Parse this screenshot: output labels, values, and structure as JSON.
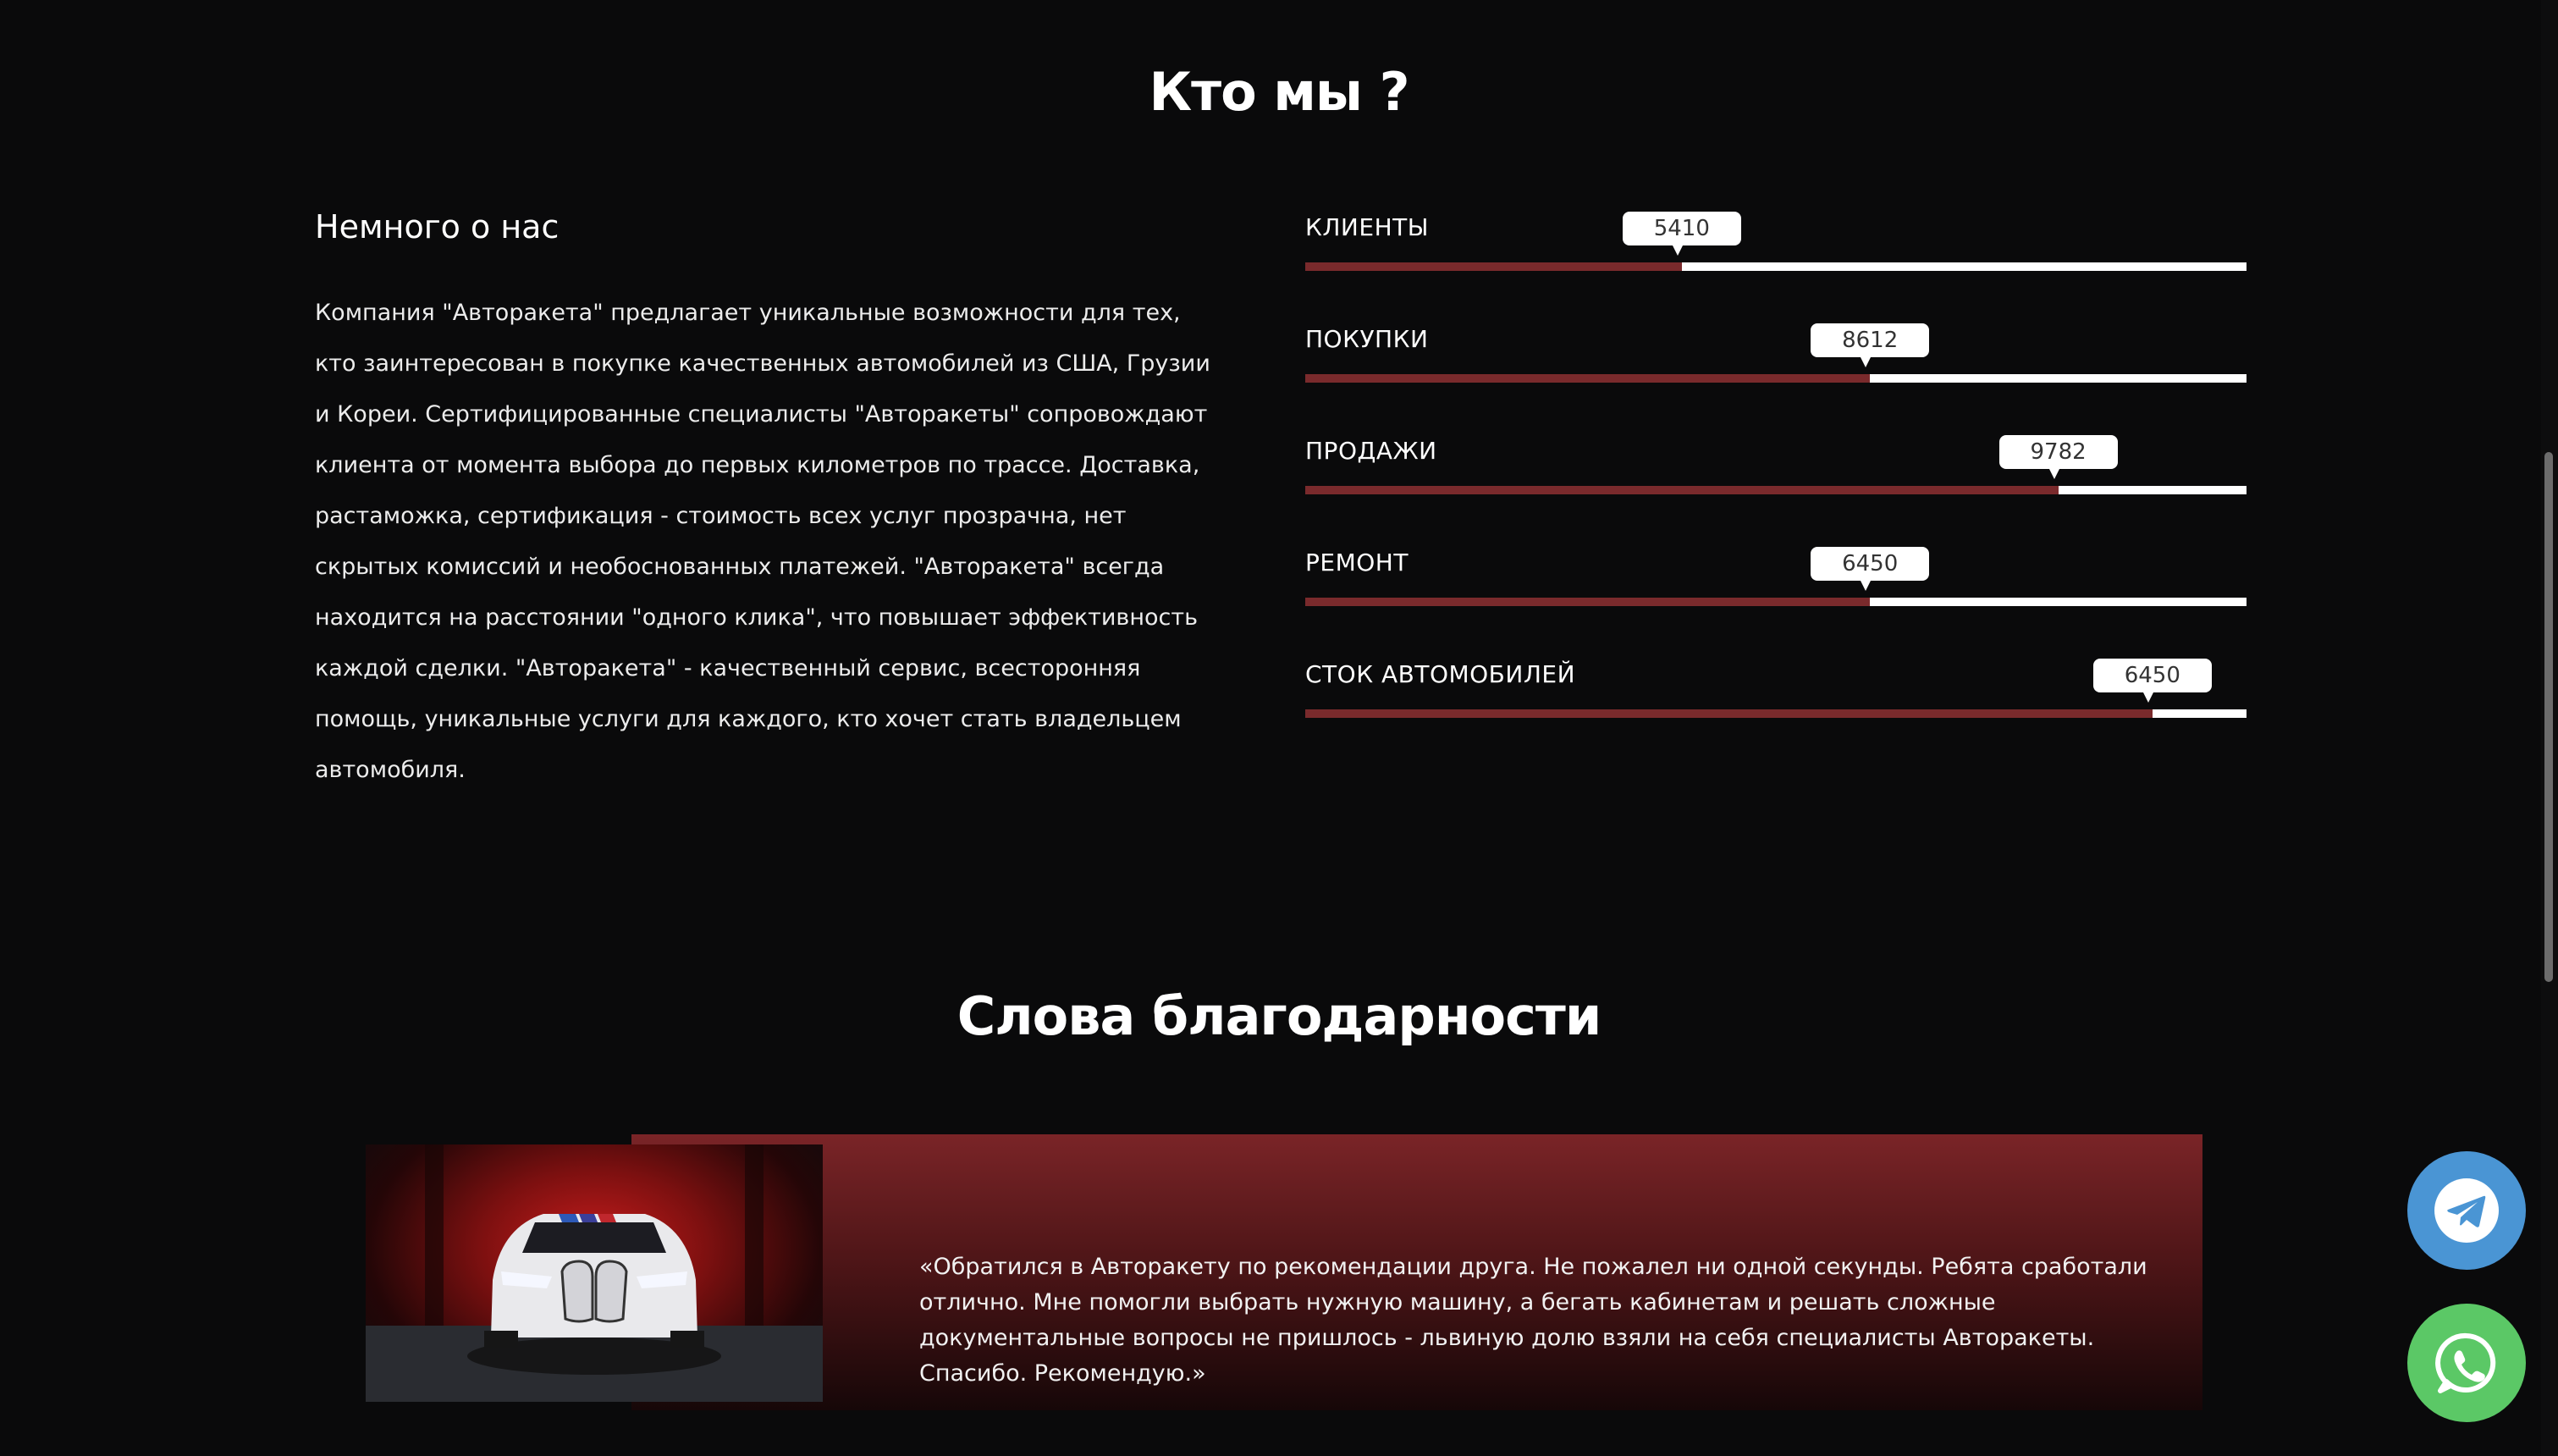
{
  "who": {
    "title": "Кто мы ?",
    "about_heading": "Немного о нас",
    "about_text": "Компания \"Авторакета\" предлагает уникальные возможности для тех, кто заинтересован в покупке качественных автомобилей из США, Грузии и Кореи. Сертифицированные специалисты \"Авторакеты\" сопровождают клиента от момента выбора до первых километров по трассе. Доставка, растаможка, сертификация - стоимость всех услуг прозрачна, нет скрытых комиссий и необоснованных платежей. \"Авторакета\" всегда находится на расстоянии \"одного клика\", что повышает эффективность каждой сделки. \"Авторакета\" - качественный сервис, всесторонняя помощь, уникальные услуги для каждого, кто хочет стать владельцем автомобиля."
  },
  "stats": [
    {
      "label": "КЛИЕНТЫ",
      "value": "5410",
      "percent": 40
    },
    {
      "label": "ПОКУПКИ",
      "value": "8612",
      "percent": 60
    },
    {
      "label": "ПРОДАЖИ",
      "value": "9782",
      "percent": 80
    },
    {
      "label": "РЕМОНТ",
      "value": "6450",
      "percent": 60
    },
    {
      "label": "СТОК АВТОМОБИЛЕЙ",
      "value": "6450",
      "percent": 90
    }
  ],
  "thanks": {
    "title": "Слова благодарности",
    "quote": "«Обратился в Авторакету по рекомендации друга. Не пожалел ни одной секунды. Ребята сработали отлично. Мне помогли выбрать нужную машину, а бегать кабинетам и решать сложные документальные вопросы не пришлось - львиную долю взяли на себя специалисты Авторакеты. Спасибо. Рекомендую.»"
  },
  "colors": {
    "background": "#0a0a0b",
    "accent": "#7a2a2c",
    "telegram": "#4a95d4",
    "whatsapp": "#5bc866"
  },
  "icons": [
    "telegram-icon",
    "whatsapp-icon"
  ]
}
